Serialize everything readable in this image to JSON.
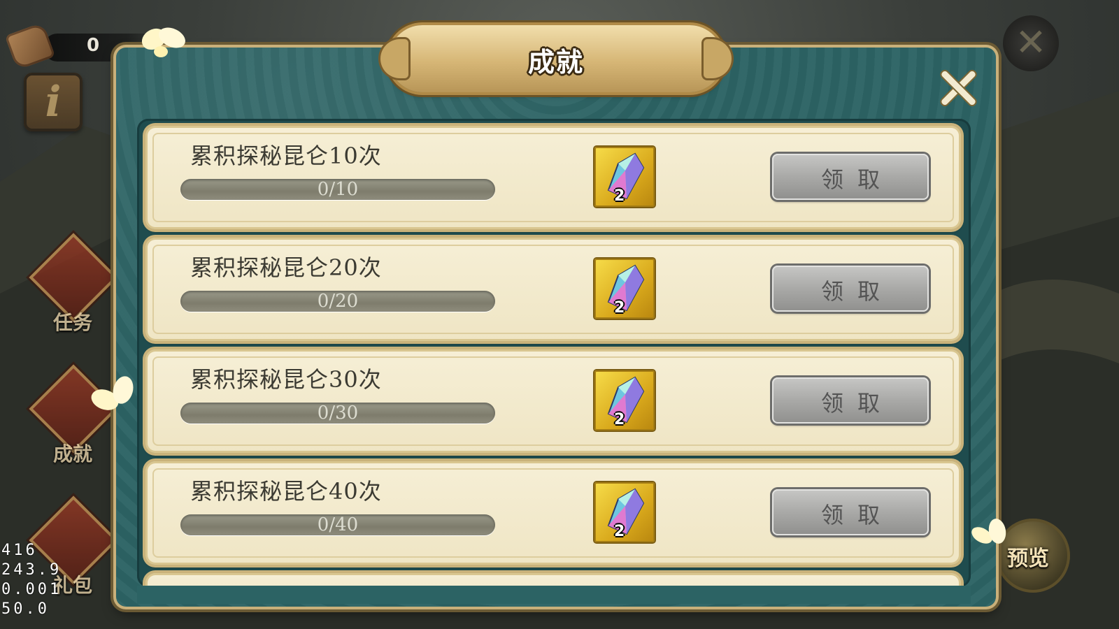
{
  "hud": {
    "counter_value": "0",
    "info_glyph": "i"
  },
  "side_menu": {
    "items": [
      {
        "label": "任务"
      },
      {
        "label": "成就"
      },
      {
        "label": "礼包"
      }
    ]
  },
  "preview": {
    "label": "预览"
  },
  "debug_stats": [
    "416",
    "243.9",
    "0.001",
    "50.0"
  ],
  "dialog": {
    "title": "成就",
    "close_icon": "close-icon",
    "achievements": [
      {
        "title": "累积探秘昆仑10次",
        "progress_text": "0/10",
        "progress": 0,
        "reward_count": "2",
        "reward_icon": "crystal-icon",
        "claim_label": "领取"
      },
      {
        "title": "累积探秘昆仑20次",
        "progress_text": "0/20",
        "progress": 0,
        "reward_count": "2",
        "reward_icon": "crystal-icon",
        "claim_label": "领取"
      },
      {
        "title": "累积探秘昆仑30次",
        "progress_text": "0/30",
        "progress": 0,
        "reward_count": "2",
        "reward_icon": "crystal-icon",
        "claim_label": "领取"
      },
      {
        "title": "累积探秘昆仑40次",
        "progress_text": "0/40",
        "progress": 0,
        "reward_count": "2",
        "reward_icon": "crystal-icon",
        "claim_label": "领取"
      }
    ]
  },
  "colors": {
    "panel_teal": "#2c6364",
    "row_cream": "#f6efd6",
    "gold": "#d6b676",
    "claim_grey": "#a9a9a7"
  }
}
